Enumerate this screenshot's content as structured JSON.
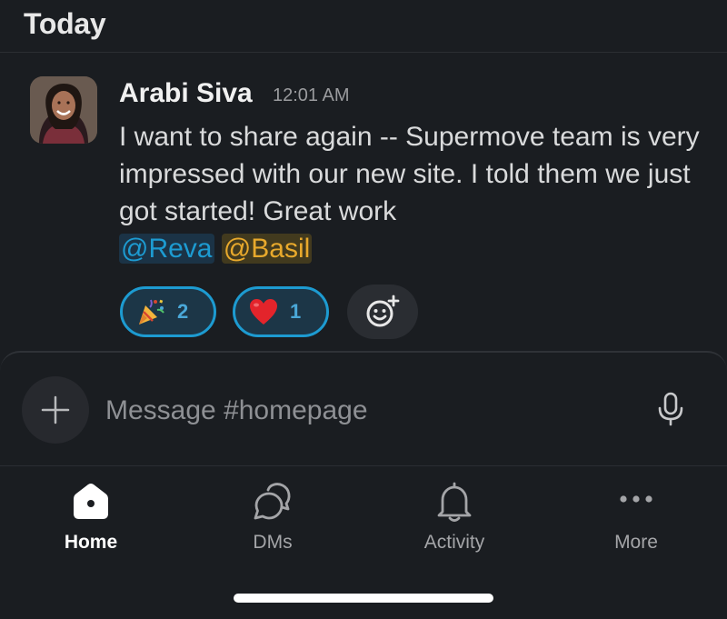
{
  "day_header": "Today",
  "message": {
    "author": "Arabi Siva",
    "time": "12:01 AM",
    "text": "I want to share again -- Supermove team is very impressed with our new site. I told them we just got started! Great work",
    "mentions": [
      "@Reva",
      "@Basil"
    ],
    "reactions": [
      {
        "emoji": "party-popper",
        "count": "2"
      },
      {
        "emoji": "red-heart",
        "count": "1"
      }
    ]
  },
  "composer": {
    "placeholder": "Message #homepage"
  },
  "tabs": [
    {
      "label": "Home",
      "icon": "home-icon",
      "active": true
    },
    {
      "label": "DMs",
      "icon": "dms-icon",
      "active": false
    },
    {
      "label": "Activity",
      "icon": "bell-icon",
      "active": false
    },
    {
      "label": "More",
      "icon": "more-icon",
      "active": false
    }
  ],
  "colors": {
    "background": "#1a1d21",
    "accent": "#1d9bd1",
    "mention_highlight": "#e8a92c"
  }
}
